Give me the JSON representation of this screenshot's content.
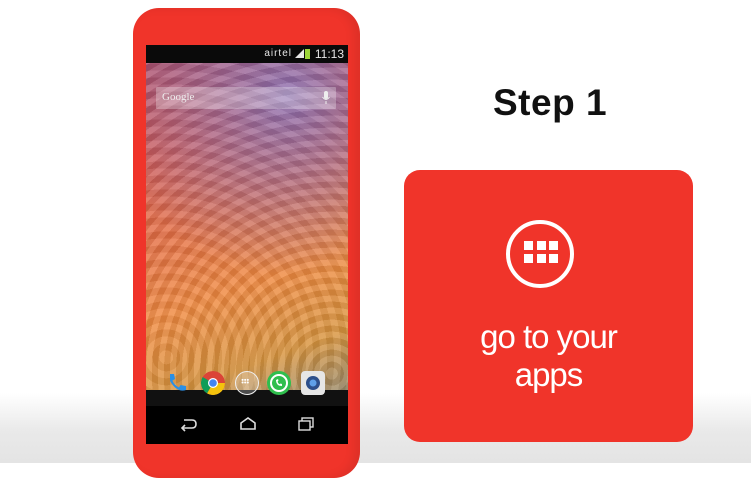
{
  "phone": {
    "status_bar": {
      "carrier": "airtel",
      "time": "11:13"
    },
    "search_bar": {
      "label": "Google"
    },
    "dock": [
      "phone-icon",
      "chrome-icon",
      "apps-icon",
      "whatsapp-icon",
      "camera-icon"
    ],
    "nav": [
      "back-icon",
      "home-icon",
      "recents-icon"
    ]
  },
  "step": {
    "title": "Step 1"
  },
  "card": {
    "icon": "apps-grid-icon",
    "line1": "go to your",
    "line2": "apps"
  },
  "colors": {
    "brand_red": "#f0342a",
    "card_text": "#ffffff"
  }
}
